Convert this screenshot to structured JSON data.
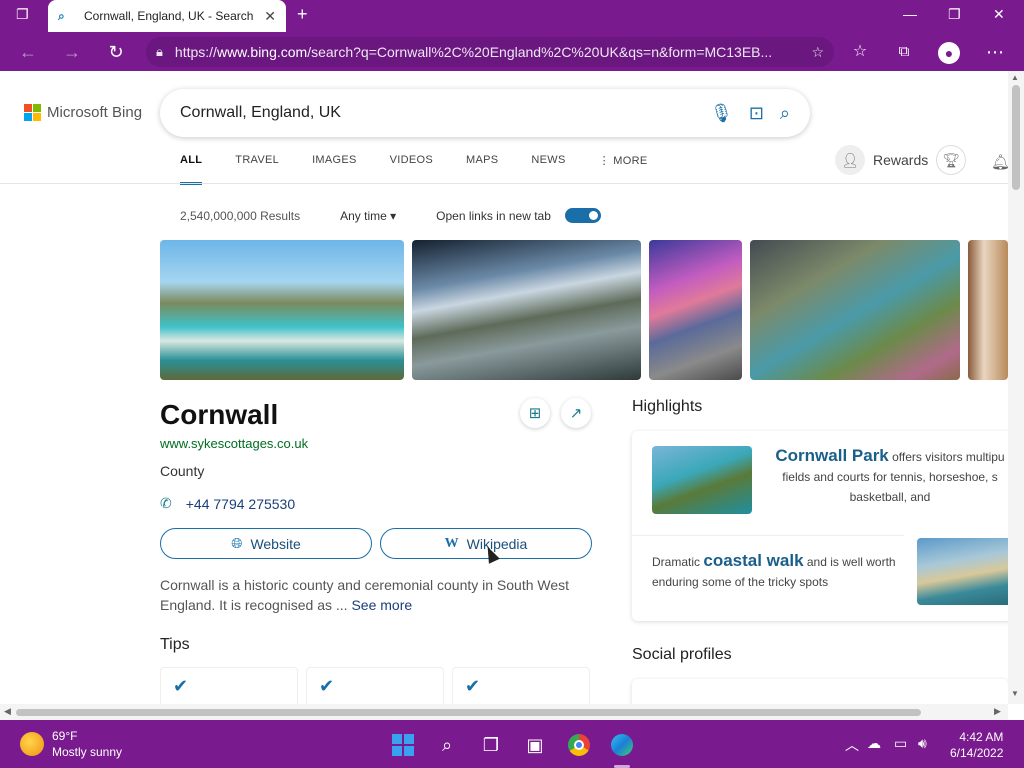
{
  "browser": {
    "tab_title": "Cornwall, England, UK - Search",
    "url_prefix": "https://",
    "url_host": "www.bing.com",
    "url_path": "/search?q=Cornwall%2C%20England%2C%20UK&qs=n&form=MC13EB..."
  },
  "bing": {
    "logo_text": "Microsoft Bing",
    "query": "Cornwall, England, UK",
    "nav": [
      "ALL",
      "TRAVEL",
      "IMAGES",
      "VIDEOS",
      "MAPS",
      "NEWS",
      "MORE"
    ],
    "rewards_label": "Rewards",
    "result_count": "2,540,000,000 Results",
    "any_time": "Any time",
    "open_links_label": "Open links in new tab"
  },
  "entity": {
    "title": "Cornwall",
    "website_url": "www.sykescottages.co.uk",
    "type": "County",
    "phone": "+44 7794 275530",
    "website_button": "Website",
    "wikipedia_button": "Wikipedia",
    "description": "Cornwall is a historic county and ceremonial county in South West England. It is recognised as ...",
    "see_more": "See more",
    "tips_heading": "Tips"
  },
  "highlights": {
    "heading": "Highlights",
    "item1_bold": "Cornwall Park",
    "item1_line1": "offers visitors multipu",
    "item1_line2": "fields and courts for tennis, horseshoe, s",
    "item1_line3": "basketball, and",
    "item2_prefix": "Dramatic",
    "item2_bold": "coastal walk",
    "item2_suffix": "and is well worth enduring some of the tricky spots",
    "social_heading": "Social profiles"
  },
  "taskbar": {
    "temperature": "69°F",
    "weather": "Mostly sunny",
    "time": "4:42 AM",
    "date": "6/14/2022"
  },
  "colors": {
    "frame": "#7a1a8f",
    "accent": "#1a6fa8"
  }
}
